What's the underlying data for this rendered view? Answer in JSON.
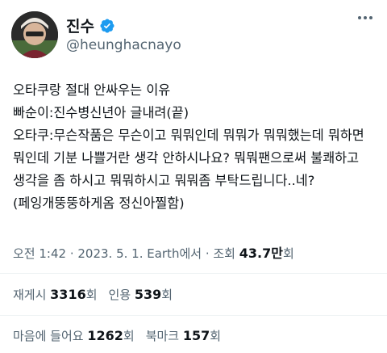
{
  "user": {
    "display_name": "진수",
    "handle": "@heunghacnayo"
  },
  "tweet": {
    "text": "오타쿠랑 절대 안싸우는 이유\n빠순이:진수병신년아 글내려(끝)\n오타쿠:무슨작품은 무슨이고 뭐뭐인데 뭐뭐가 뭐뭐했는데 뭐하면 뭐인데 기분 나쁠거란 생각 안하시나요? 뭐뭐팬으로써 불쾌하고 생각을 좀 하시고 뭐뭐하시고 뭐뭐좀 부탁드립니다..네?(페잉개뚱뚱하게옴 정신아찔함)"
  },
  "meta": {
    "time": "오전 1:42 · 2023. 5. 1. Earth에서 · 조회 ",
    "views": "43.7만",
    "views_suffix": "회"
  },
  "stats1": {
    "retweets_label": "재게시 ",
    "retweets": "3316",
    "retweets_unit": "회",
    "quotes_label": "인용 ",
    "quotes": "539",
    "quotes_unit": "회"
  },
  "stats2": {
    "likes_label": "마음에 들어요 ",
    "likes": "1262",
    "likes_unit": "회",
    "bookmarks_label": "북마크 ",
    "bookmarks": "157",
    "bookmarks_unit": "회"
  },
  "colors": {
    "verified": "#1d9bf0",
    "secondary_text": "#536471"
  }
}
